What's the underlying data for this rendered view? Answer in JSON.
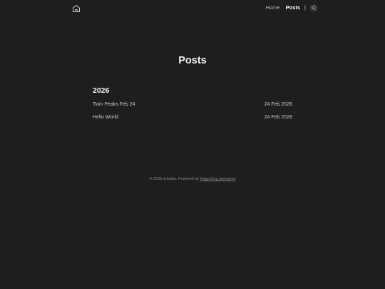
{
  "header": {
    "home_icon": "home-icon",
    "nav": [
      {
        "label": "Home",
        "active": false
      },
      {
        "label": "Posts",
        "active": true
      }
    ],
    "separator": "|",
    "theme_icon": "sun-icon"
  },
  "main": {
    "title": "Posts",
    "groups": [
      {
        "year": "2026",
        "posts": [
          {
            "title": "Twin Peaks Feb 24",
            "date": "24 Feb 2026"
          },
          {
            "title": "Hello World",
            "date": "24 Feb 2026"
          }
        ]
      }
    ]
  },
  "footer": {
    "copyright": "© 2026 arkadio.",
    "powered_by": "Powered by",
    "link_text": "Hugo blog awesome"
  },
  "colors": {
    "background": "#1d1e20",
    "text": "#dadadb",
    "muted": "#8b8b8c"
  }
}
